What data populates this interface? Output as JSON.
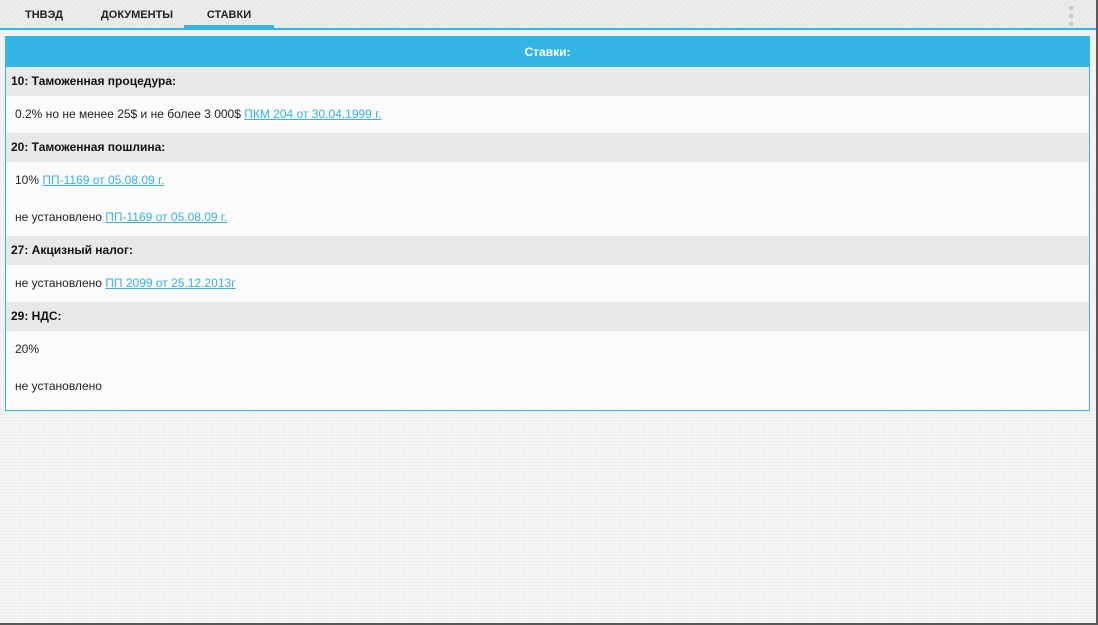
{
  "tabs": [
    "ТНВЭД",
    "ДОКУМЕНТЫ",
    "СТАВКИ"
  ],
  "active_tab": "СТАВКИ",
  "icons": {
    "overflow_menu": "overflow-menu-icon"
  },
  "colors": {
    "accent": "#33b5e5",
    "section_bg": "#e8e8e8"
  },
  "panel": {
    "title": "Ставки:",
    "sections": [
      {
        "title": "10: Таможенная процедура:",
        "rows": [
          {
            "text": "0.2% но не менее 25$ и не более 3 000$",
            "link": "ПКМ 204 от 30.04.1999 г."
          }
        ]
      },
      {
        "title": "20: Таможенная пошлина:",
        "rows": [
          {
            "text": "10%",
            "link": "ПП-1169 от 05.08.09 г."
          },
          {
            "text": "не установлено",
            "link": "ПП-1169 от 05.08.09 г."
          }
        ]
      },
      {
        "title": "27: Акцизный налог:",
        "rows": [
          {
            "text": "не установлено",
            "link": "ПП 2099 от 25.12.2013г"
          }
        ]
      },
      {
        "title": "29: НДС:",
        "rows": [
          {
            "text": "20%",
            "link": ""
          },
          {
            "text": "не установлено",
            "link": ""
          }
        ]
      }
    ]
  }
}
